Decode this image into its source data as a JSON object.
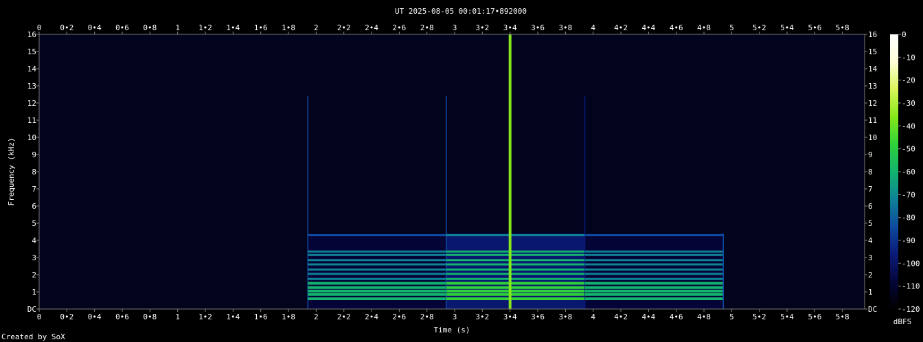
{
  "chart_data": {
    "type": "heatmap",
    "title": "UT 2025-08-05 00:01:17•892000",
    "xlabel": "Time (s)",
    "ylabel": "Frequency (kHz)",
    "footer": "Created by SoX",
    "colorbar_label": "dBFS",
    "xlim": [
      0,
      5.96
    ],
    "ylim": [
      0,
      16
    ],
    "x_ticks": [
      "0",
      "0•2",
      "0•4",
      "0•6",
      "0•8",
      "1",
      "1•2",
      "1•4",
      "1•6",
      "1•8",
      "2",
      "2•2",
      "2•4",
      "2•6",
      "2•8",
      "3",
      "3•2",
      "3•4",
      "3•6",
      "3•8",
      "4",
      "4•2",
      "4•4",
      "4•6",
      "4•8",
      "5",
      "5•2",
      "5•4",
      "5•6",
      "5•8"
    ],
    "y_ticks": [
      "DC",
      "1",
      "2",
      "3",
      "4",
      "5",
      "6",
      "7",
      "8",
      "9",
      "10",
      "11",
      "12",
      "13",
      "14",
      "15",
      "16"
    ],
    "colorbar_ticks": [
      "0",
      "-10",
      "-20",
      "-30",
      "-40",
      "-50",
      "-60",
      "-70",
      "-80",
      "-90",
      "-100",
      "-110",
      "-120"
    ],
    "colorbar_range": [
      -120,
      0
    ],
    "colormap": [
      "#000000",
      "#04063a",
      "#0a1a78",
      "#0d4aa0",
      "#0f8296",
      "#12b46e",
      "#2fd23a",
      "#86e81a",
      "#d8f45a",
      "#ffffd8",
      "#ffffff"
    ],
    "tone_segments": [
      {
        "t_start": 1.94,
        "t_end": 2.94,
        "level_db": -80
      },
      {
        "t_start": 2.94,
        "t_end": 3.94,
        "level_db": -70
      },
      {
        "t_start": 3.94,
        "t_end": 4.94,
        "level_db": -82
      }
    ],
    "tone_harmonics_khz": [
      0.6,
      0.85,
      1.05,
      1.25,
      1.5,
      1.75,
      2.05,
      2.3,
      2.6,
      2.85,
      3.15,
      3.35,
      4.3
    ],
    "impulses": [
      {
        "t": 3.4,
        "level_db": -35,
        "f_max_khz": 16
      }
    ],
    "grid": false
  }
}
